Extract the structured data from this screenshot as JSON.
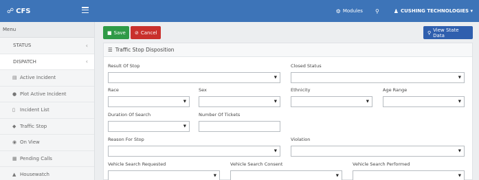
{
  "topbar": {
    "brand": "CFS",
    "modules_label": "Modules",
    "org_label": "CUSHING TECHNOLOGIES",
    "colors": {
      "navbar": "#3d74b8"
    }
  },
  "sidebar": {
    "header": "Menu",
    "sections": [
      {
        "label": "STATUS"
      },
      {
        "label": "DISPATCH"
      }
    ],
    "items": [
      {
        "label": "Active Incident",
        "icon": "document-icon"
      },
      {
        "label": "Plot Active Incident",
        "icon": "globe-icon"
      },
      {
        "label": "Incident List",
        "icon": "file-icon"
      },
      {
        "label": "Traffic Stop",
        "icon": "car-icon"
      },
      {
        "label": "On View",
        "icon": "eye-icon"
      },
      {
        "label": "Pending Calls",
        "icon": "clipboard-icon"
      },
      {
        "label": "Housewatch",
        "icon": "house-icon"
      }
    ]
  },
  "toolbar": {
    "save_label": "Save",
    "cancel_label": "Cancel",
    "view_state_label": "View State Data",
    "colors": {
      "save": "#2f9a47",
      "cancel": "#c9302c",
      "view": "#2f5fae"
    }
  },
  "panel": {
    "title": "Traffic Stop Disposition",
    "fields": {
      "result_of_stop": "Result Of Stop",
      "closed_status": "Closed Status",
      "race": "Race",
      "sex": "Sex",
      "ethnicity": "Ethnicity",
      "age_range": "Age Range",
      "duration_of_search": "Duration Of Search",
      "number_of_tickets": "Number Of Tickets",
      "reason_for_stop": "Reason For Stop",
      "violation": "Violation",
      "vehicle_search_requested": "Vehicle Search Requested",
      "vehicle_search_consent": "Vehicle Search Consent",
      "vehicle_search_performed": "Vehicle Search Performed"
    }
  }
}
